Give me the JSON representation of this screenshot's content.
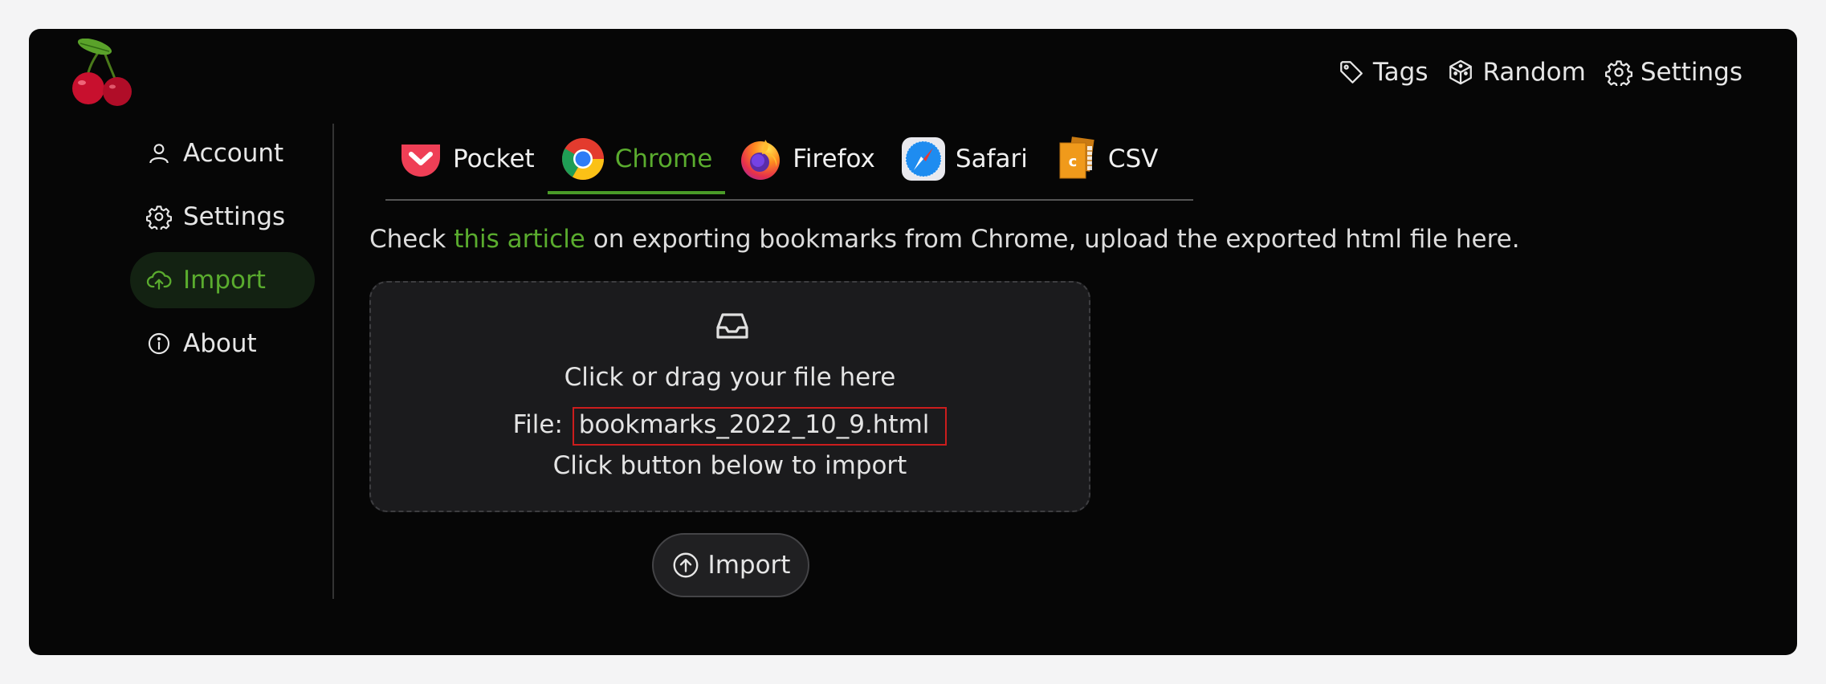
{
  "topnav": {
    "tags_label": "Tags",
    "random_label": "Random",
    "settings_label": "Settings"
  },
  "sidebar": {
    "items": [
      {
        "label": "Account",
        "icon": "user-icon",
        "active": false
      },
      {
        "label": "Settings",
        "icon": "gear-icon",
        "active": false
      },
      {
        "label": "Import",
        "icon": "cloud-upload-icon",
        "active": true
      },
      {
        "label": "About",
        "icon": "info-icon",
        "active": false
      }
    ]
  },
  "tabs": [
    {
      "label": "Pocket",
      "icon": "pocket-icon",
      "active": false
    },
    {
      "label": "Chrome",
      "icon": "chrome-icon",
      "active": true
    },
    {
      "label": "Firefox",
      "icon": "firefox-icon",
      "active": false
    },
    {
      "label": "Safari",
      "icon": "safari-icon",
      "active": false
    },
    {
      "label": "CSV",
      "icon": "csv-icon",
      "active": false
    }
  ],
  "description": {
    "prefix": "Check ",
    "link_text": "this article",
    "suffix": " on exporting bookmarks from Chrome, upload the exported html file here."
  },
  "dropzone": {
    "instruction": "Click or drag your file here",
    "file_label": "File:",
    "file_name": "bookmarks_2022_10_9.html",
    "hint": "Click button below to import"
  },
  "import_button": {
    "label": "Import"
  },
  "colors": {
    "accent": "#5aac2e",
    "background": "#060606",
    "highlight_box": "#cc1d1d"
  }
}
